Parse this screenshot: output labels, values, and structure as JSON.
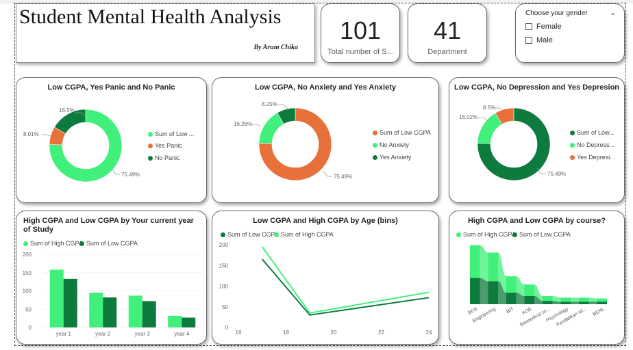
{
  "report": {
    "title": "Student Mental Health Analysis",
    "author": "By Arum Chika"
  },
  "kpis": [
    {
      "value": "101",
      "label": "Total number of S..."
    },
    {
      "value": "41",
      "label": "Department"
    }
  ],
  "slicer": {
    "header": "Choose your gender",
    "options": [
      "Female",
      "Male"
    ]
  },
  "colors": {
    "light_green": "#40f07a",
    "dark_green": "#0d7a3e",
    "orange": "#e8703a"
  },
  "donuts": [
    {
      "title": "Low CGPA, Yes Panic and No Panic",
      "chart_data": {
        "type": "pie",
        "slices": [
          {
            "label": "Sum of Low ...",
            "pct_label": "75.49%",
            "value": 75.49,
            "color": "#40f07a"
          },
          {
            "label": "Yes Panic",
            "pct_label": "8.01%",
            "value": 8.01,
            "color": "#e8703a"
          },
          {
            "label": "No Panic",
            "pct_label": "16.5%",
            "value": 16.5,
            "color": "#0d7a3e"
          }
        ]
      }
    },
    {
      "title": "Low CGPA, No Anxiety and Yes Anxiety",
      "chart_data": {
        "type": "pie",
        "slices": [
          {
            "label": "Sum of Low CGPA",
            "pct_label": "75.49%",
            "value": 75.49,
            "color": "#e8703a"
          },
          {
            "label": "No Anxiety",
            "pct_label": "16.26%",
            "value": 16.26,
            "color": "#40f07a"
          },
          {
            "label": "Yes Anxiety",
            "pct_label": "8.25%",
            "value": 8.25,
            "color": "#0d7a3e"
          }
        ]
      }
    },
    {
      "title": "Low CGPA, No Depression and Yes Depresion",
      "chart_data": {
        "type": "pie",
        "slices": [
          {
            "label": "Sum of Low...",
            "pct_label": "75.49%",
            "value": 75.49,
            "color": "#0d7a3e"
          },
          {
            "label": "No Depress...",
            "pct_label": "16.02%",
            "value": 16.02,
            "color": "#40f07a"
          },
          {
            "label": "Yes Depresi...",
            "pct_label": "8.5%",
            "value": 8.5,
            "color": "#e8703a"
          }
        ]
      }
    }
  ],
  "bar_chart": {
    "title": "High CGPA and Low CGPA by Your current year of Study",
    "chart_data": {
      "type": "bar",
      "categories": [
        "year 1",
        "year 2",
        "year 3",
        "year 4"
      ],
      "series": [
        {
          "name": "Sum of High CGPA",
          "values": [
            158,
            95,
            87,
            32
          ],
          "color": "#40f07a"
        },
        {
          "name": "Sum of Low CGPA",
          "values": [
            133,
            82,
            72,
            27
          ],
          "color": "#0d7a3e"
        }
      ],
      "yticks": [
        "0",
        "50",
        "100",
        "150",
        "200"
      ],
      "ylim": [
        0,
        200
      ]
    }
  },
  "line_chart": {
    "title": "Low CGPA and High CGPA by Age (bins)",
    "chart_data": {
      "type": "line",
      "x": [
        17,
        19,
        24
      ],
      "series": [
        {
          "name": "Sum of Low CGPA",
          "values": [
            165,
            30,
            72
          ],
          "color": "#0d7a3e"
        },
        {
          "name": "Sum of High CGPA",
          "values": [
            195,
            35,
            85
          ],
          "color": "#40f07a"
        }
      ],
      "xticks": [
        "16",
        "18",
        "20",
        "22",
        "24"
      ],
      "yticks": [
        "0",
        "50",
        "100",
        "150",
        "200"
      ],
      "xlim": [
        16,
        24
      ],
      "ylim": [
        0,
        200
      ]
    }
  },
  "ribbon_chart": {
    "title": "High CGPA and Low CGPA by course?",
    "chart_data": {
      "type": "area",
      "categories": [
        "BCS",
        "Engineering",
        "BIT",
        "KOE",
        "Biomedical sc...",
        "Psychology",
        "Pendidikan isl...",
        "BENL"
      ],
      "series": [
        {
          "name": "Sum of High CGPA",
          "values": [
            40,
            35,
            20,
            14,
            6,
            5,
            5,
            4
          ],
          "color": "#40f07a"
        },
        {
          "name": "Sum of Low CGPA",
          "values": [
            32,
            28,
            14,
            10,
            4,
            3,
            3,
            3
          ],
          "color": "#0d7a3e"
        }
      ]
    }
  }
}
